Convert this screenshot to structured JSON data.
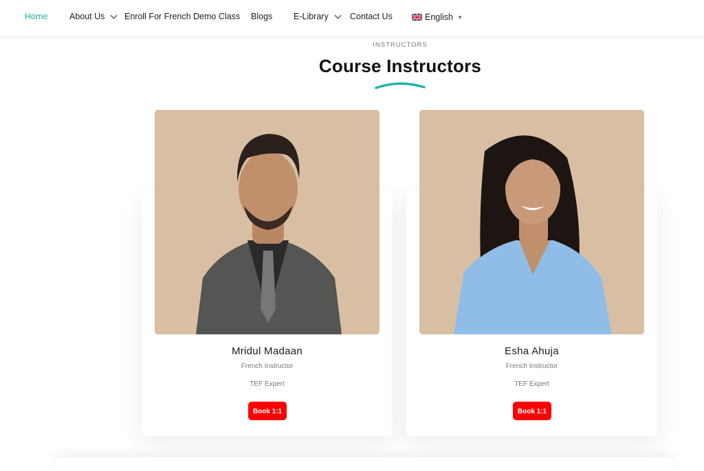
{
  "nav": {
    "items": [
      {
        "label": "Home",
        "active": true,
        "dropdown": false
      },
      {
        "label": "About Us",
        "active": false,
        "dropdown": true
      },
      {
        "label": "Enroll For French Demo Class",
        "active": false,
        "dropdown": false
      },
      {
        "label": "Blogs",
        "active": false,
        "dropdown": false
      },
      {
        "label": "E-Library",
        "active": false,
        "dropdown": true
      },
      {
        "label": "Contact Us",
        "active": false,
        "dropdown": false
      }
    ],
    "language": {
      "label": "English",
      "flag_icon": "uk-flag-icon"
    },
    "accent_color": "#1fb3a5"
  },
  "section": {
    "eyebrow": "INSTRUCTORS",
    "title": "Course Instructors"
  },
  "instructors": [
    {
      "name": "Mridul Madaan",
      "role": "French Instructor",
      "specialty": "TEF Expert",
      "button": "Book 1:1"
    },
    {
      "name": "Esha Ahuja",
      "role": "French Instructor",
      "specialty": "TEF Expert",
      "button": "Book 1:1"
    }
  ],
  "colors": {
    "button": "#ff0000",
    "photo_bg": "#d8bfa3"
  }
}
